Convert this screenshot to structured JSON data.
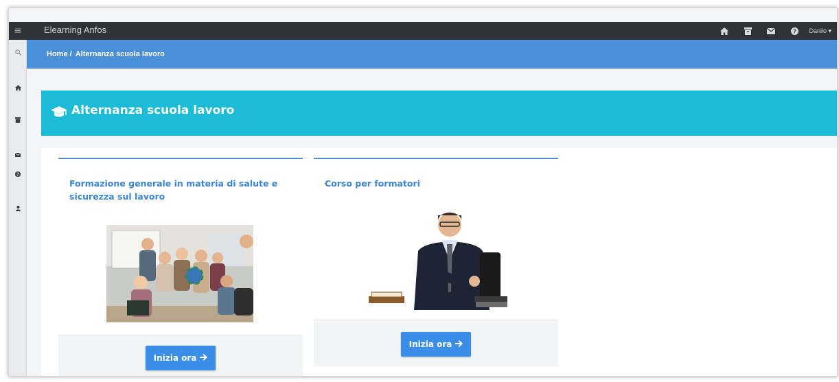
{
  "app": {
    "title": "Elearning Anfos"
  },
  "topbar": {
    "user_label": "Danilo ▾",
    "icons": [
      "home-icon",
      "archive-icon",
      "envelope-icon",
      "question-circle-icon"
    ]
  },
  "sidebar": {
    "icons": [
      "search-icon",
      "home-icon",
      "archive-icon",
      "envelope-icon",
      "question-circle-icon",
      "user-icon"
    ]
  },
  "breadcrumb": {
    "home": "Home /",
    "current": "Alternanza scuola lavoro"
  },
  "section": {
    "title": "Alternanza scuola lavoro",
    "icon": "graduation-cap-icon"
  },
  "courses": [
    {
      "title": "Formazione generale in materia di salute e sicurezza sul lavoro",
      "button": "Inizia ora"
    },
    {
      "title": "Corso per formatori",
      "button": "Inizia ora"
    }
  ],
  "colors": {
    "topbar": "#2f3237",
    "breadcrumb": "#4a90d9",
    "section_header": "#1cbcd6",
    "button": "#3a8ee6",
    "card_title": "#3a86d4"
  }
}
